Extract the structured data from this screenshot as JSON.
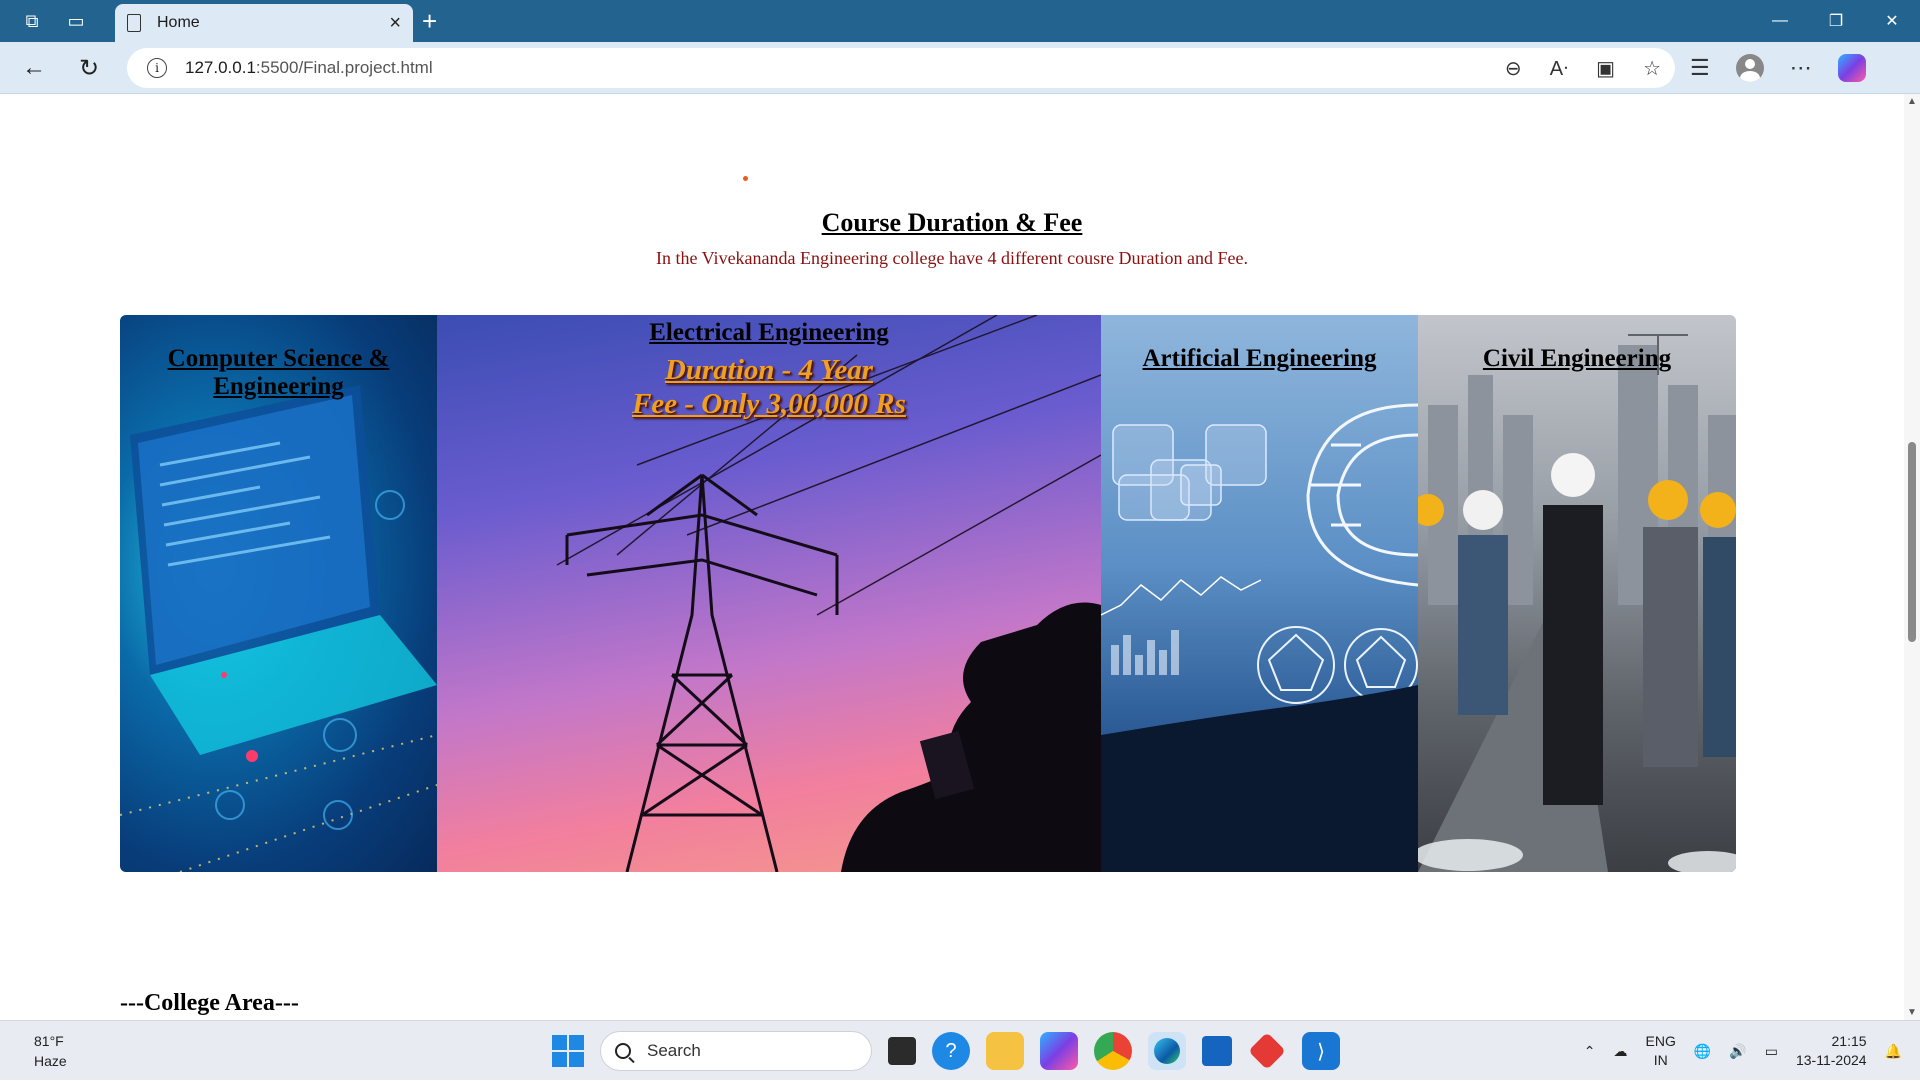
{
  "browser": {
    "tab_title": "Home",
    "url_host": "127.0.0.1",
    "url_path": ":5500/Final.project.html"
  },
  "page": {
    "section_title": "Course Duration & Fee",
    "section_subtitle": "In the Vivekananda Engineering college have 4 different cousre Duration and Fee.",
    "cards": [
      {
        "title": "Computer Science & Engineering"
      },
      {
        "title": "Electrical Engineering",
        "duration": "Duration - 4 Year",
        "fee": "Fee - Only 3,00,000 Rs"
      },
      {
        "title": "Artificial Engineering"
      },
      {
        "title": "Civil Engineering"
      }
    ],
    "college_area": "---College Area---"
  },
  "taskbar": {
    "temperature": "81°F",
    "weather": "Haze",
    "search_label": "Search",
    "lang_top": "ENG",
    "lang_bottom": "IN",
    "time": "21:15",
    "date": "13-11-2024"
  }
}
